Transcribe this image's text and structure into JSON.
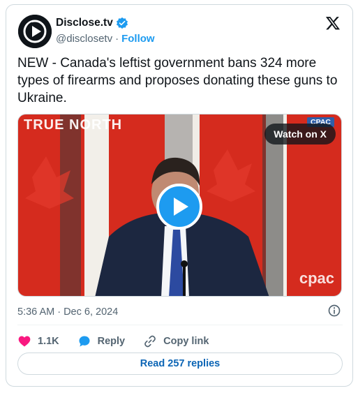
{
  "author": {
    "display_name": "Disclose.tv",
    "handle": "@disclosetv",
    "separator": "·",
    "follow_label": "Follow",
    "verified": true
  },
  "tweet": {
    "text": "NEW - Canada's leftist government bans 324 more types of firearms and proposes donating these guns to Ukraine.",
    "timestamp": "5:36 AM · Dec 6, 2024"
  },
  "media": {
    "watermark": "TRUE NORTH",
    "channel_badge": "CPAC",
    "watch_label": "Watch on X",
    "channel_watermark": "cpac"
  },
  "actions": {
    "like_count": "1.1K",
    "reply_label": "Reply",
    "copy_link_label": "Copy link"
  },
  "footer": {
    "read_replies_label": "Read 257 replies"
  },
  "colors": {
    "accent": "#1d9bf0",
    "like": "#f91880",
    "muted": "#536471",
    "flag_red": "#d52b1e"
  },
  "icons": [
    "avatar-play-logo",
    "verified-badge-icon",
    "x-logo-icon",
    "play-icon",
    "info-icon",
    "heart-icon",
    "reply-bubble-icon",
    "link-icon"
  ]
}
